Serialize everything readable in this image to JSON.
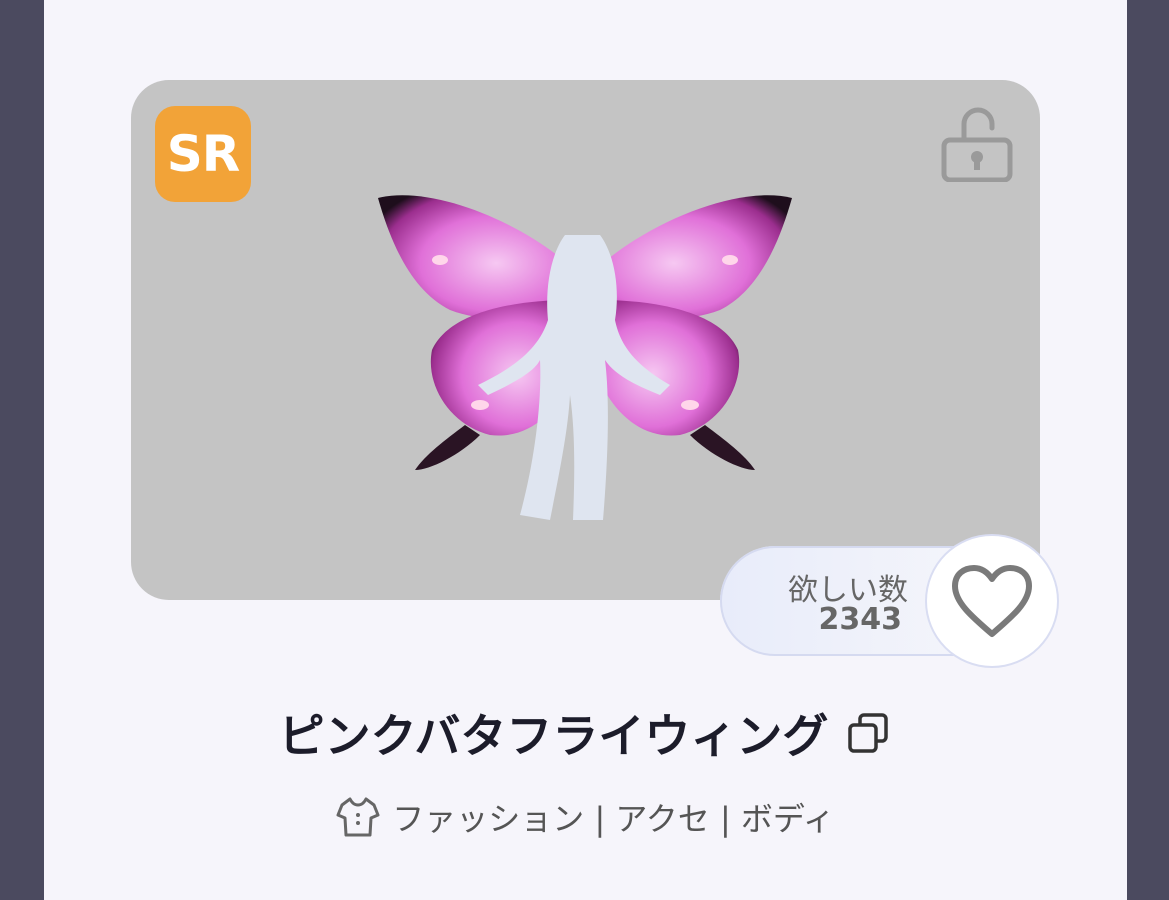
{
  "item": {
    "rarity": "SR",
    "name": "ピンクバタフライウィング",
    "category": "ファッション | アクセ | ボディ"
  },
  "wish": {
    "label": "欲しい数",
    "count": "2343"
  },
  "icons": {
    "lock": "unlocked-padlock-icon",
    "heart": "heart-icon",
    "copy": "copy-icon",
    "category": "shirt-icon"
  },
  "colors": {
    "rarity_badge": "#f2a338",
    "preview_bg": "#c4c4c4",
    "card_bg": "#f6f5fb",
    "outer_bg": "#4b4a5f"
  }
}
